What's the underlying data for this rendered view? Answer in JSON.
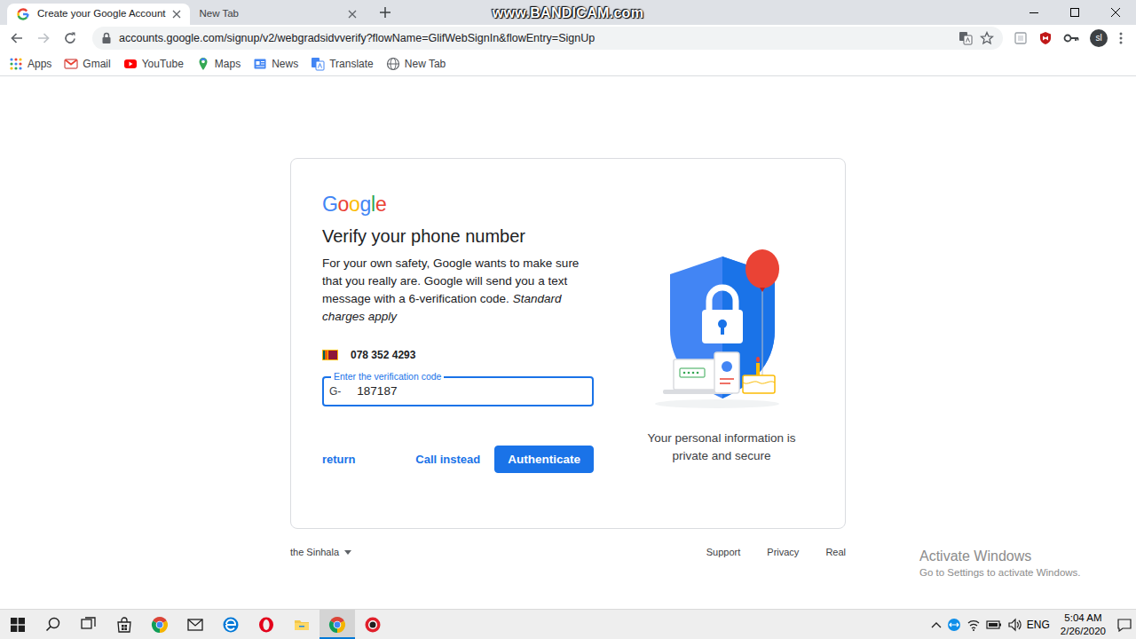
{
  "recorder": {
    "watermark": "www.BANDICAM.com"
  },
  "browser": {
    "tabs": [
      {
        "title": "Create your Google Account",
        "kind": "google",
        "selected": true
      },
      {
        "title": "New Tab",
        "kind": "blank",
        "selected": false
      }
    ],
    "address": "accounts.google.com/signup/v2/webgradsidvverify?flowName=GlifWebSignIn&flowEntry=SignUp",
    "profile": "sl",
    "bookmarks": [
      {
        "label": "Apps",
        "kind": "apps"
      },
      {
        "label": "Gmail",
        "kind": "gmail"
      },
      {
        "label": "YouTube",
        "kind": "youtube"
      },
      {
        "label": "Maps",
        "kind": "maps"
      },
      {
        "label": "News",
        "kind": "news"
      },
      {
        "label": "Translate",
        "kind": "translate"
      },
      {
        "label": "New Tab",
        "kind": "globe"
      }
    ]
  },
  "page": {
    "logo": "Google",
    "heading": "Verify your phone number",
    "intro": "For your own safety, Google wants to make sure that you really are. Google will send you a text message with a 6-verification code.",
    "intro_note": "Standard charges apply",
    "phone": "078 352 4293",
    "code_field": {
      "label": "Enter the verification code",
      "prefix": "G-",
      "value": "187187",
      "focused": true
    },
    "buttons": {
      "back": "return",
      "call": "Call instead",
      "submit": "Authenticate"
    },
    "caption": "Your personal information is private and secure",
    "language": "the Sinhala",
    "footer_links": [
      "Support",
      "Privacy",
      "Real"
    ]
  },
  "activation": {
    "title": "Activate Windows",
    "subtitle": "Go to Settings to activate Windows."
  },
  "taskbar": {
    "apps": [
      {
        "kind": "start",
        "selected": false
      },
      {
        "kind": "search",
        "selected": false
      },
      {
        "kind": "taskview",
        "selected": false
      },
      {
        "kind": "store",
        "selected": false
      },
      {
        "kind": "chrome",
        "selected": false
      },
      {
        "kind": "mail",
        "selected": false
      },
      {
        "kind": "edge",
        "selected": false
      },
      {
        "kind": "opera",
        "selected": false
      },
      {
        "kind": "explorer",
        "selected": false
      },
      {
        "kind": "chrome",
        "selected": true
      },
      {
        "kind": "bandicam",
        "selected": false
      }
    ],
    "language": "ENG",
    "time": "5:04 AM",
    "date": "2/26/2020"
  }
}
